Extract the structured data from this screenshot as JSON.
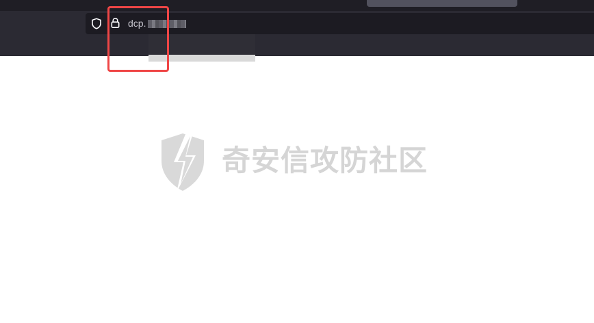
{
  "browser": {
    "address_bar": {
      "url_visible": "dcp.",
      "url_redacted": true,
      "shield_icon": "shield-icon",
      "lock_icon": "lock-icon"
    }
  },
  "annotation": {
    "color": "#ef4646"
  },
  "watermark": {
    "text": "奇安信攻防社区",
    "logo_icon": "qianxin-shield-bolt-logo",
    "color": "#d5d5d5"
  },
  "colors": {
    "toolbar": "#2b2a33",
    "urlbar": "#1c1b22",
    "page": "#ffffff"
  }
}
